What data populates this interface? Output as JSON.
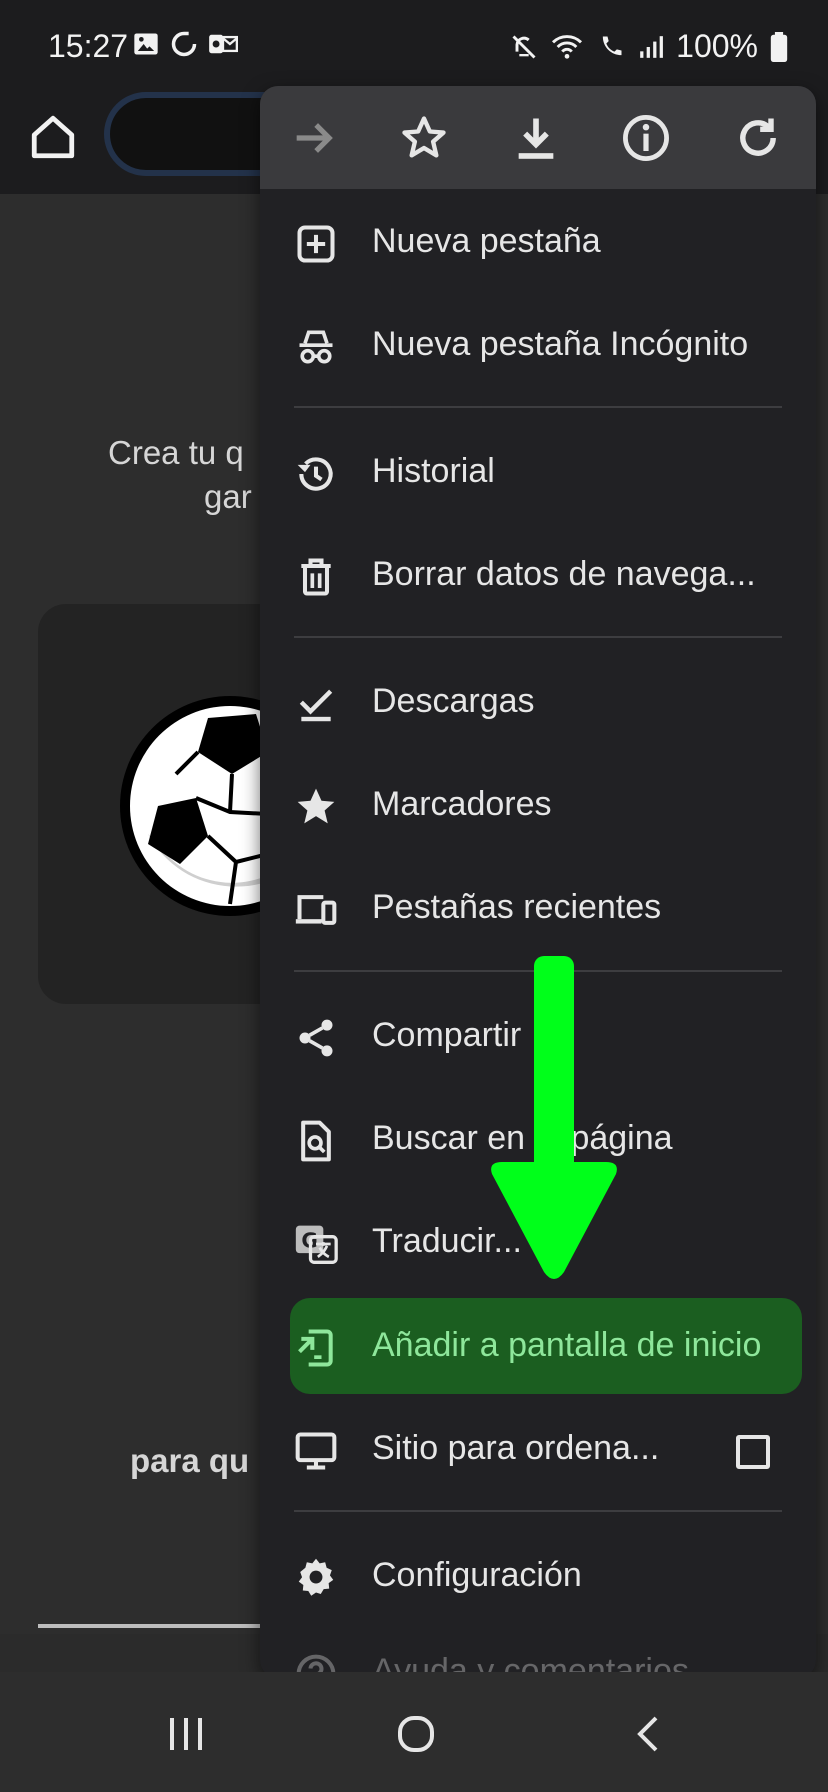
{
  "status_bar": {
    "time": "15:27",
    "battery": "100%",
    "icons": [
      "gallery-icon",
      "sync-icon",
      "outlook-icon",
      "mute-icon",
      "wifi-icon",
      "wifi-calling-icon",
      "signal-icon",
      "battery-icon"
    ]
  },
  "page": {
    "text_line1": "Crea tu q",
    "text_line2": "gar",
    "bold_text": "para qu"
  },
  "menu": {
    "top_icons": [
      "forward-icon",
      "star-outline-icon",
      "download-icon",
      "info-icon",
      "refresh-icon"
    ],
    "items": [
      {
        "label": "Nueva pestaña",
        "icon": "new-tab-icon"
      },
      {
        "label": "Nueva pestaña Incógnito",
        "icon": "incognito-icon"
      },
      {
        "label": "Historial",
        "icon": "history-icon"
      },
      {
        "label": "Borrar datos de navega...",
        "icon": "trash-icon"
      },
      {
        "label": "Descargas",
        "icon": "downloads-icon"
      },
      {
        "label": "Marcadores",
        "icon": "star-icon"
      },
      {
        "label": "Pestañas recientes",
        "icon": "devices-icon"
      },
      {
        "label": "Compartir",
        "icon": "share-icon"
      },
      {
        "label": "Buscar en la página",
        "icon": "find-in-page-icon"
      },
      {
        "label": "Traducir...",
        "icon": "translate-icon"
      },
      {
        "label": "Añadir a pantalla de inicio",
        "icon": "add-to-home-icon"
      },
      {
        "label": "Sitio para ordena...",
        "icon": "desktop-icon"
      },
      {
        "label": "Configuración",
        "icon": "settings-icon"
      },
      {
        "label": "Ayuda y comentarios",
        "icon": "help-icon"
      }
    ],
    "desktop_site_checked": false,
    "highlight_color": "#1b5e20",
    "arrow_color": "#00ff1a"
  },
  "nav_bar": {
    "buttons": [
      "recent-apps-icon",
      "home-circle-icon",
      "back-icon"
    ]
  }
}
